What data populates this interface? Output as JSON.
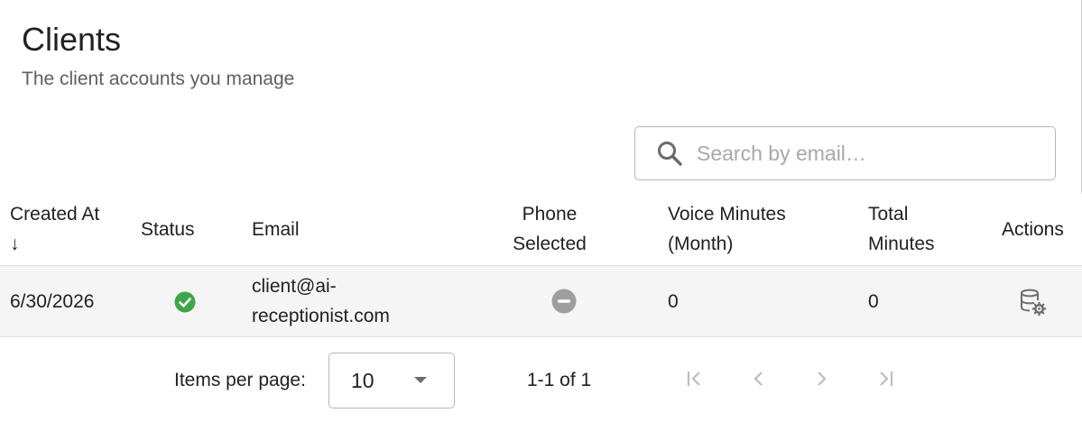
{
  "page": {
    "title": "Clients",
    "subtitle": "The client accounts you manage"
  },
  "search": {
    "placeholder": "Search by email…",
    "value": "",
    "icon": "search-icon"
  },
  "table": {
    "columns": {
      "created_at": [
        "Created At",
        "↓"
      ],
      "status": "Status",
      "email": "Email",
      "phone_selected": [
        "Phone",
        "Selected"
      ],
      "voice_minutes": [
        "Voice Minutes",
        "(Month)"
      ],
      "total_minutes": [
        "Total",
        "Minutes"
      ],
      "actions": "Actions"
    },
    "rows": [
      {
        "created_at": "6/30/2026",
        "status_icon": "check-circle-icon",
        "status_color": "#3ea54a",
        "email_lines": [
          "client@ai-",
          "receptionist.com"
        ],
        "phone_icon": "minus-circle-icon",
        "phone_color": "#9e9e9e",
        "voice_minutes": "0",
        "total_minutes": "0",
        "action_icon": "database-settings-icon"
      }
    ]
  },
  "paginator": {
    "items_per_page_label": "Items per page:",
    "page_size": "10",
    "range_label": "1-1 of 1",
    "icons": [
      "first-page-icon",
      "previous-page-icon",
      "next-page-icon",
      "last-page-icon"
    ],
    "disabled_color": "#bdbdbd"
  }
}
